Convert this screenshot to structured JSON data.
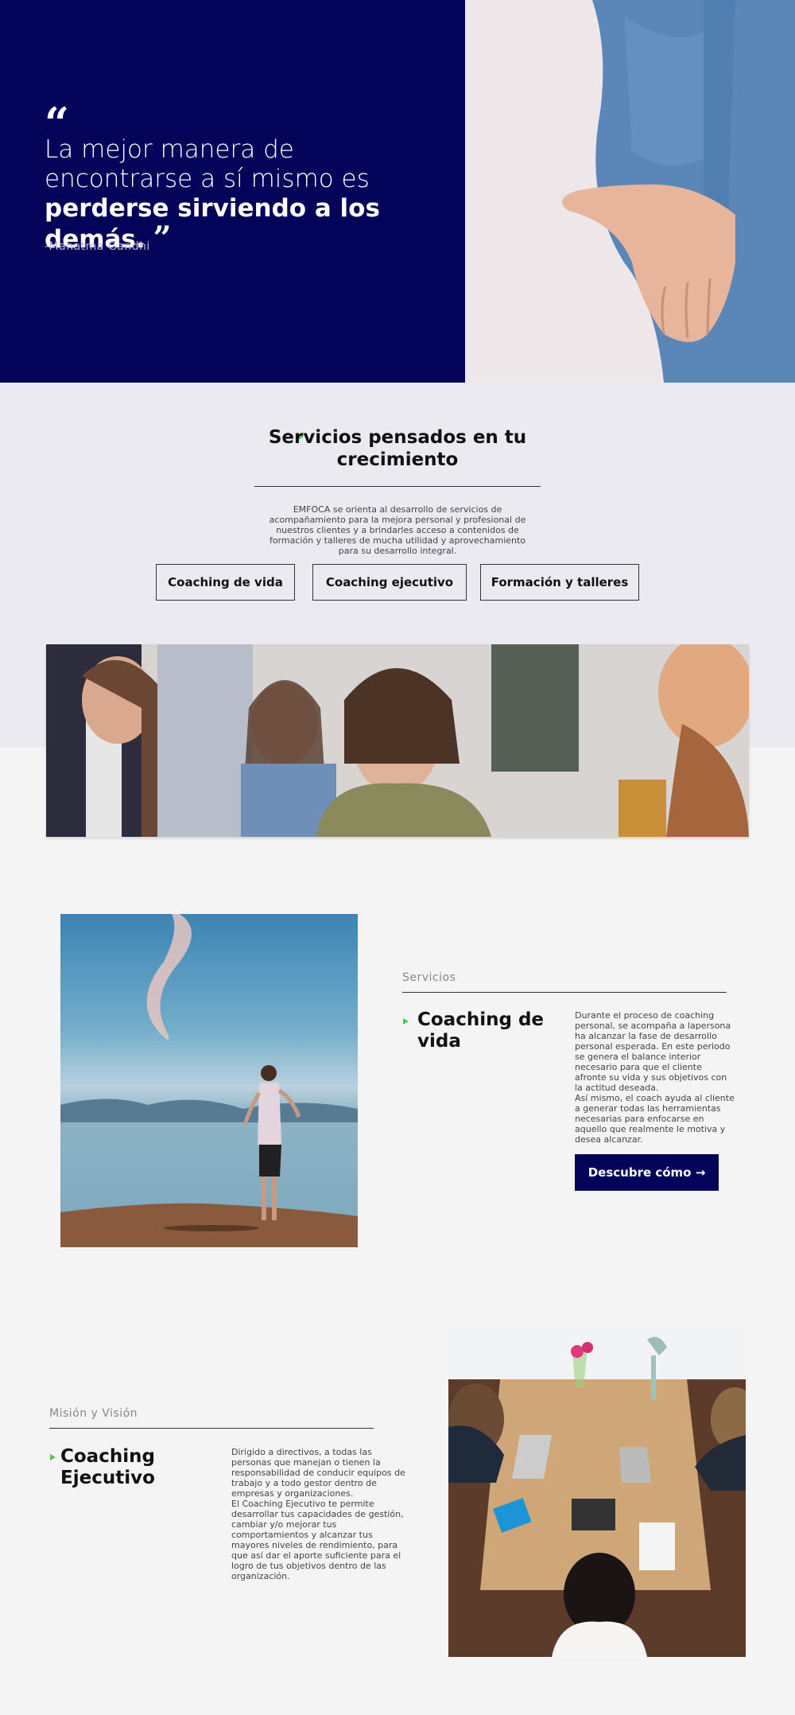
{
  "hero": {
    "quote_open": "“",
    "quote_part1": "La mejor manera de encontrarse a sí mismo es ",
    "quote_bold": "perderse sirviendo a los demás.",
    "quote_close": "”",
    "author": "-Mahatma Gandhi",
    "bg_color": "#04035a"
  },
  "services": {
    "title": "Servicios pensados en tu crecimiento",
    "description": "EMFOCA se orienta al desarrollo de servicios de acompañamiento para la mejora personal y profesional de nuestros clientes y a brindarles acceso a contenidos de formación y talleres de mucha utilidad y aprovechamiento para su desarrollo integral.",
    "buttons": [
      "Coaching de vida",
      "Coaching ejecutivo",
      "Formación y talleres"
    ],
    "accent_color": "#55c254"
  },
  "vida": {
    "label": "Servicios",
    "title": "Coaching de vida",
    "description": "Durante el proceso de coaching personal, se acompaña a lapersona ha alcanzar la fase de desarrollo personal esperada. En este periodo se genera el balance interior necesario para que el cliente afronte su vida y sus objetivos con la actitud deseada.\nAsí mismo, el coach ayuda al cliente a generar todas las herramientas necesarias para enfocarse en aquello que realmente le motiva y desea alcanzar.",
    "cta": "Descubre cómo →"
  },
  "ejecutivo": {
    "label": "Misión y Visión",
    "title": "Coaching Ejecutivo",
    "description": "Dirigido a directivos, a todas las personas que manejan o tienen la responsabilidad de conducir equipos de trabajo y a todo gestor dentro de empresas y organizaciones.\nEl Coaching Ejecutivo te permite desarrollar tus capacidades de gestión, cambiar y/o mejorar tus comportamientos y alcanzar tus mayores niveles de rendimiento, para que así dar el aporte suficiente para el logro de tus objetivos dentro de las organización."
  }
}
